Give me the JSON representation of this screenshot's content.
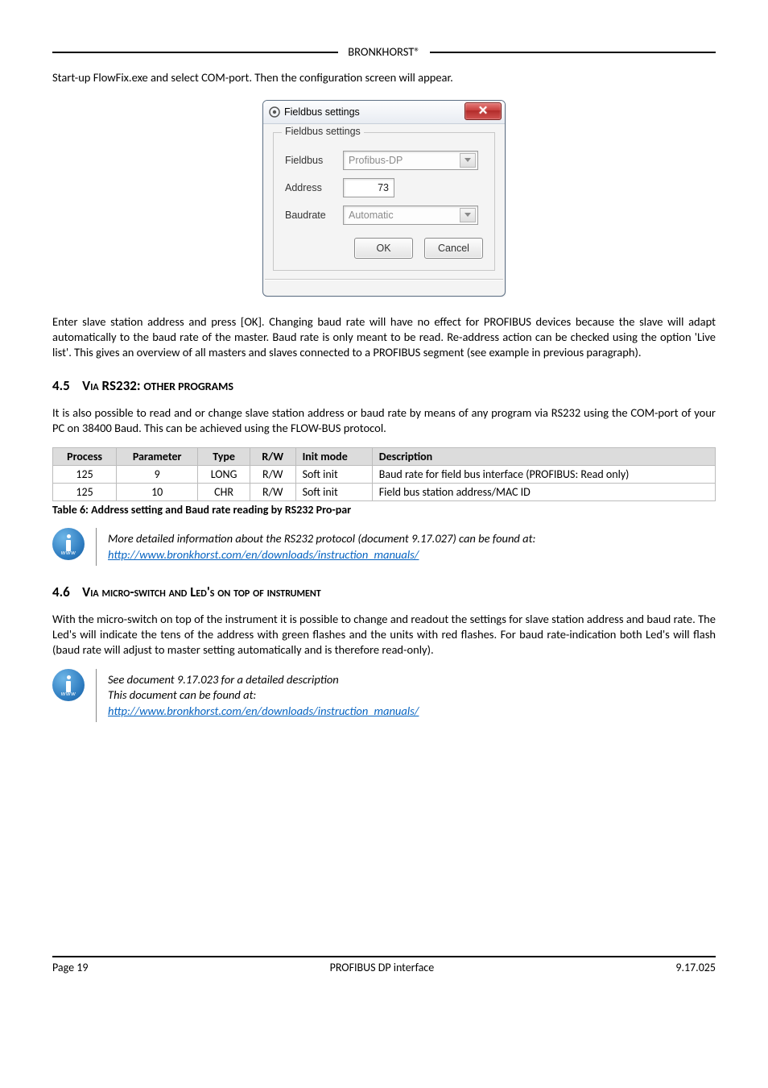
{
  "header": {
    "brand": "BRONKHORST®"
  },
  "intro": "Start-up FlowFix.exe and select COM-port. Then the configuration screen will appear.",
  "dialog": {
    "title": "Fieldbus settings",
    "legend": "Fieldbus settings",
    "fieldbus": {
      "label": "Fieldbus",
      "value": "Profibus-DP"
    },
    "address": {
      "label": "Address",
      "value": "73"
    },
    "baudrate": {
      "label": "Baudrate",
      "value": "Automatic"
    },
    "ok": "OK",
    "cancel": "Cancel"
  },
  "para_ok": "Enter slave station address and press [OK]. Changing baud rate will have no effect for PROFIBUS devices because the slave will adapt automatically to the baud rate of the master.  Baud rate is only meant to be read. Re-address action can be checked using the option 'Live list'. This gives an overview of all masters and slaves connected to a PROFIBUS segment (see example in previous paragraph).",
  "sec45": {
    "num": "4.5",
    "lead": "V",
    "main": "ia RS232:",
    "tail": " other programs"
  },
  "para_45": "It is also possible to read and or change slave station address or baud rate by means of any program via RS232 using the COM-port of your PC on 38400 Baud. This can be achieved using the FLOW-BUS protocol.",
  "table": {
    "headers": [
      "Process",
      "Parameter",
      "Type",
      "R/W",
      "Init mode",
      "Description"
    ],
    "rows": [
      {
        "process": "125",
        "parameter": "9",
        "type": "LONG",
        "rw": "R/W",
        "init": "Soft init",
        "desc": "Baud rate for field bus interface (PROFIBUS: Read only)"
      },
      {
        "process": "125",
        "parameter": "10",
        "type": "CHR",
        "rw": "R/W",
        "init": "Soft init",
        "desc": "Field bus station address/MAC ID"
      }
    ],
    "caption": "Table 6: Address setting and Baud rate reading by RS232 Pro-par"
  },
  "info1": {
    "line1": "More detailed information about the RS232 protocol (document 9.17.027) can be  found at:",
    "link": "http://www.bronkhorst.com/en/downloads/instruction_manuals/"
  },
  "sec46": {
    "num": "4.6",
    "lead": "V",
    "main": "ia micro-switch and L",
    "mid": "ed's on top of instrument"
  },
  "para_46": "With the micro-switch on top of the instrument it is possible to change and readout the settings for slave station address and baud rate. The Led's will indicate the tens of the address with green flashes and the units with red flashes. For baud rate-indication both Led's will flash (baud rate will adjust to master setting automatically and is therefore read-only).",
  "info2": {
    "line1": "See document 9.17.023 for a detailed description",
    "line2": "This document can be found at:",
    "link": "http://www.bronkhorst.com/en/downloads/instruction_manuals/"
  },
  "footer": {
    "left": "Page 19",
    "center": "PROFIBUS DP interface",
    "right": "9.17.025"
  },
  "chart_data": {
    "type": "table",
    "title": "Table 6: Address setting and Baud rate reading by RS232 Pro-par",
    "columns": [
      "Process",
      "Parameter",
      "Type",
      "R/W",
      "Init mode",
      "Description"
    ],
    "rows": [
      [
        125,
        9,
        "LONG",
        "R/W",
        "Soft init",
        "Baud rate for field bus interface (PROFIBUS: Read only)"
      ],
      [
        125,
        10,
        "CHR",
        "R/W",
        "Soft init",
        "Field bus station address/MAC ID"
      ]
    ]
  }
}
